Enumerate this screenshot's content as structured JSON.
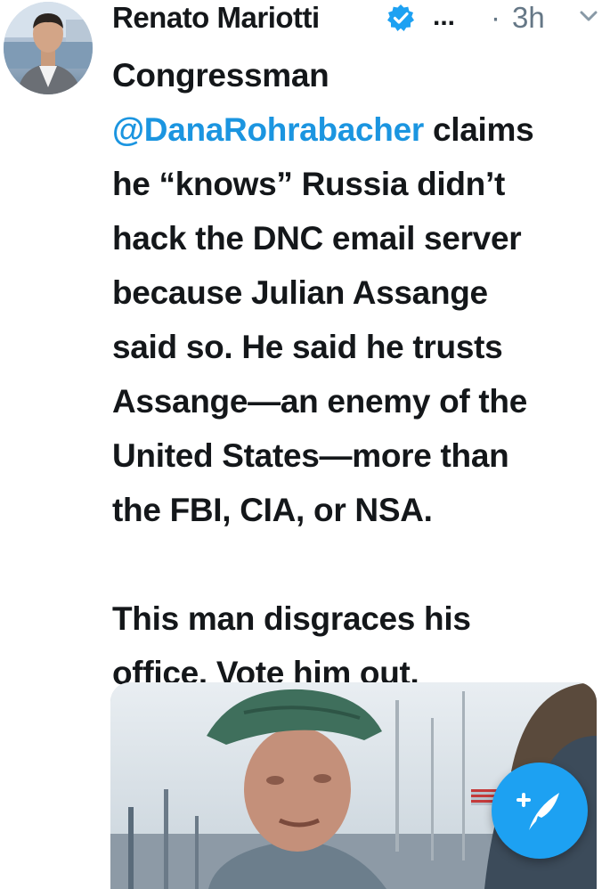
{
  "tweet": {
    "author_name": "Renato Mariotti",
    "more_indicator": "...",
    "separator": "·",
    "time": "3h",
    "text": {
      "line1": "Congressman",
      "mention": "@DanaRohrabacher",
      "line2_rest": " claims",
      "line3": "he “knows” Russia didn’t",
      "line4": "hack the DNC email server",
      "line5": "because Julian Assange",
      "line6": "said so. He said he trusts",
      "line7": "Assange—an enemy of the",
      "line8": "United States—more than",
      "line9": "the FBI, CIA, or NSA.",
      "line10": "This man disgraces his",
      "line11": "office. Vote him out."
    },
    "icons": {
      "verified": "verified-badge-icon",
      "caret": "chevron-down-icon",
      "compose": "compose-tweet-icon"
    }
  },
  "colors": {
    "text": "#14171a",
    "mention": "#1b95e0",
    "muted": "#657786",
    "fab": "#1da1f2",
    "verified": "#1da1f2"
  }
}
